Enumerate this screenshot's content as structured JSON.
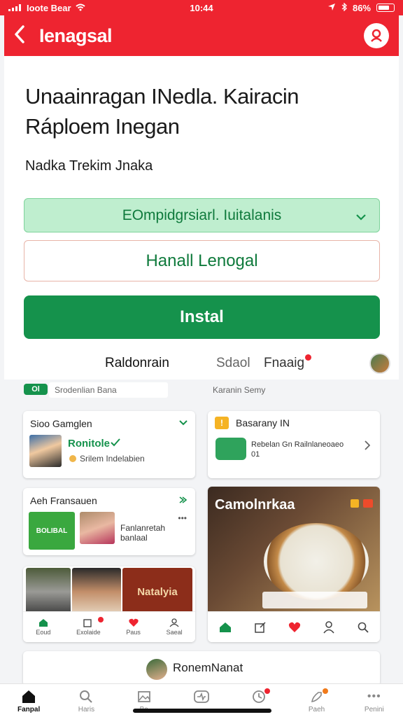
{
  "status_bar": {
    "carrier": "Ioote Bear",
    "time": "10:44",
    "battery": "86%"
  },
  "app_bar": {
    "title": "Ienagsal"
  },
  "main": {
    "headline": "Unaainragan INedla. Kairacin Ráploem Inegan",
    "subline": "Nadka Trekim Jnaka",
    "dropdown_value": "EOmpidgrsiarl. Iuitalanis",
    "secondary_button": "Hanall Lenogal",
    "install_button": "Instal"
  },
  "tabs": {
    "tab1": "Raldonrain",
    "tab2": "Sdaol",
    "tab3": "Fnaaig"
  },
  "filter": {
    "chip": "Ol",
    "field": "Srodenlian Bana",
    "right": "Karanin Semy"
  },
  "cards": {
    "card1": {
      "title": "Sioo Gamglen",
      "name": "Ronitole",
      "meta": "Srilem Indelabien"
    },
    "card2": {
      "title": "Basarany IN",
      "desc": "Rebelan Gn Railnlaneoaeo",
      "num": "01"
    },
    "card3": {
      "title": "Aeh Fransauen",
      "logo_text": "BOLIBAL",
      "line1": "Fanlanretah",
      "line2": "banlaal"
    },
    "card4": {
      "overlay_title": "Camolnrkaa"
    },
    "card5": {
      "sign_text": "Natalyia"
    },
    "card6": {
      "name": "RonemNanat"
    }
  },
  "mini_nav_labels": [
    "Eoud",
    "Exolaide",
    "Paus",
    "Saeal"
  ],
  "bottom_nav": [
    {
      "label": "Fanpal",
      "icon": "home-icon"
    },
    {
      "label": "Haris",
      "icon": "search-icon"
    },
    {
      "label": "Ba",
      "icon": "image-icon"
    },
    {
      "label": "",
      "icon": "activity-icon"
    },
    {
      "label": "",
      "icon": "clock-icon"
    },
    {
      "label": "Paeh",
      "icon": "rocket-icon"
    },
    {
      "label": "Penini",
      "icon": "more-icon"
    }
  ],
  "colors": {
    "brand_red": "#ee2430",
    "brand_green": "#15924c"
  }
}
